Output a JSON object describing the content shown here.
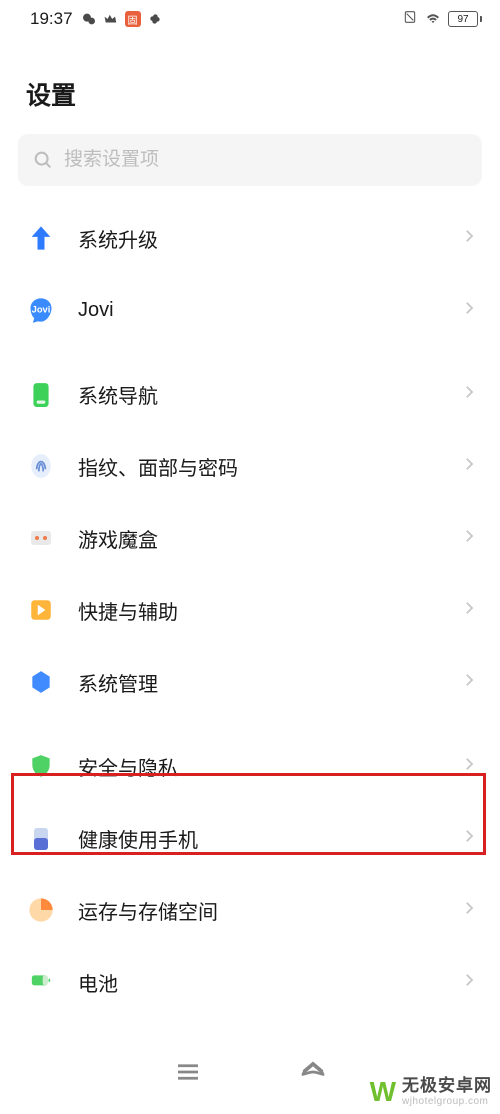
{
  "status": {
    "time": "19:37",
    "battery_text": "97"
  },
  "page": {
    "title": "设置"
  },
  "search": {
    "placeholder": "搜索设置项"
  },
  "items": [
    {
      "label": "系统升级",
      "key": "system-upgrade"
    },
    {
      "label": "Jovi",
      "key": "jovi"
    },
    {
      "label": "系统导航",
      "key": "system-navigation"
    },
    {
      "label": "指纹、面部与密码",
      "key": "biometrics-password"
    },
    {
      "label": "游戏魔盒",
      "key": "game-box"
    },
    {
      "label": "快捷与辅助",
      "key": "shortcut-accessibility"
    },
    {
      "label": "系统管理",
      "key": "system-management"
    },
    {
      "label": "安全与隐私",
      "key": "security-privacy"
    },
    {
      "label": "健康使用手机",
      "key": "digital-wellbeing"
    },
    {
      "label": "运存与存储空间",
      "key": "ram-storage"
    },
    {
      "label": "电池",
      "key": "battery"
    }
  ],
  "watermark": {
    "brand": "无极安卓网",
    "url": "wjhotelgroup.com"
  }
}
